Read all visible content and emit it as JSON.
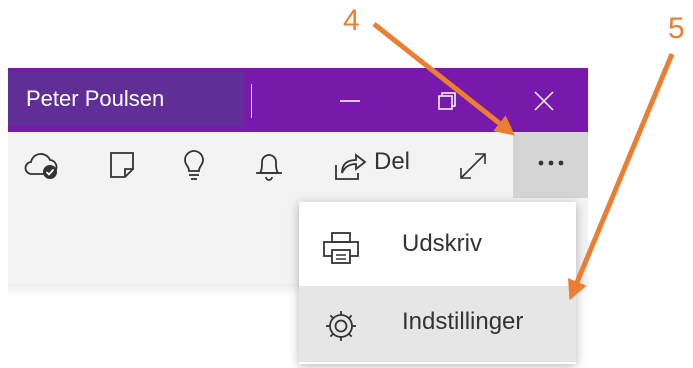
{
  "window": {
    "user_name": "Peter Poulsen",
    "title_bg": "#7719aa",
    "user_bg": "#5f2f97"
  },
  "toolbar": {
    "icons": [
      "cloud-sync-icon",
      "sticky-note-icon",
      "lightbulb-icon",
      "bell-icon",
      "share-icon",
      "expand-icon",
      "more-icon"
    ],
    "share_label": "Del"
  },
  "menu": {
    "items": [
      {
        "label": "Udskriv",
        "icon": "printer-icon"
      },
      {
        "label": "Indstillinger",
        "icon": "gear-icon",
        "hovered": true
      }
    ]
  },
  "callouts": [
    {
      "label": "4",
      "color": "#ed7d31"
    },
    {
      "label": "5",
      "color": "#ed7d31"
    }
  ]
}
